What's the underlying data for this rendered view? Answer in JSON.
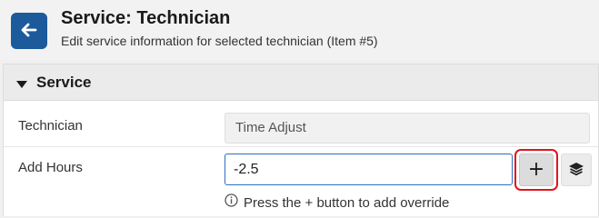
{
  "header": {
    "title": "Service: Technician",
    "subtitle": "Edit service information for selected technician (Item #5)"
  },
  "panel": {
    "title": "Service"
  },
  "fields": {
    "technician_label": "Technician",
    "technician_value": "Time Adjust",
    "add_hours_label": "Add Hours",
    "add_hours_value": "-2.5",
    "add_button_label": "+",
    "hint_text": "Press the + button to add override"
  },
  "icons": {
    "back": "arrow-left-icon",
    "caret": "caret-down-icon",
    "layers": "layers-icon",
    "info": "info-circle-icon"
  },
  "colors": {
    "back_button": "#1c5a9c",
    "input_focus_border": "#2d6fc0",
    "highlight_box": "#e0141e"
  }
}
